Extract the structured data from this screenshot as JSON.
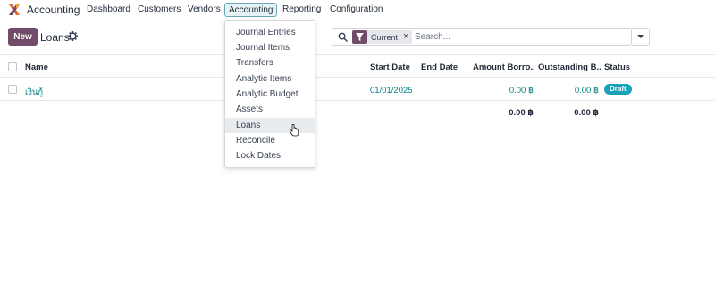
{
  "app": {
    "title": "Accounting"
  },
  "nav": {
    "dashboard": "Dashboard",
    "customers": "Customers",
    "vendors": "Vendors",
    "accounting": "Accounting",
    "reporting": "Reporting",
    "configuration": "Configuration"
  },
  "controls": {
    "new_label": "New",
    "breadcrumb": "Loans",
    "facet_label": "Current",
    "search_placeholder": "Search..."
  },
  "table": {
    "headers": {
      "name": "Name",
      "start_date": "Start Date",
      "end_date": "End Date",
      "amount_borrowed": "Amount Borro...",
      "outstanding": "Outstanding B...",
      "status": "Status"
    },
    "rows": [
      {
        "name": "เงินกู้",
        "start_date": "01/01/2025",
        "end_date": "",
        "amount_borrowed": "0.00 ฿",
        "outstanding": "0.00 ฿",
        "status": "Draft"
      }
    ],
    "totals": {
      "amount_borrowed": "0.00 ฿",
      "outstanding": "0.00 ฿"
    }
  },
  "menu": {
    "items": [
      "Journal Entries",
      "Journal Items",
      "Transfers",
      "Analytic Items",
      "Analytic Budget",
      "Assets",
      "Loans",
      "Reconcile",
      "Lock Dates"
    ],
    "hovered": "Loans"
  },
  "colors": {
    "brand": "#714B67",
    "link": "#017e84",
    "badge": "#17a2b8"
  },
  "icons": {
    "logo": "odoo-accounting-logo",
    "gear": "gear-icon",
    "search": "search-icon",
    "filter": "filter-icon",
    "close": "close-icon",
    "dropdown": "caret-down-icon"
  }
}
